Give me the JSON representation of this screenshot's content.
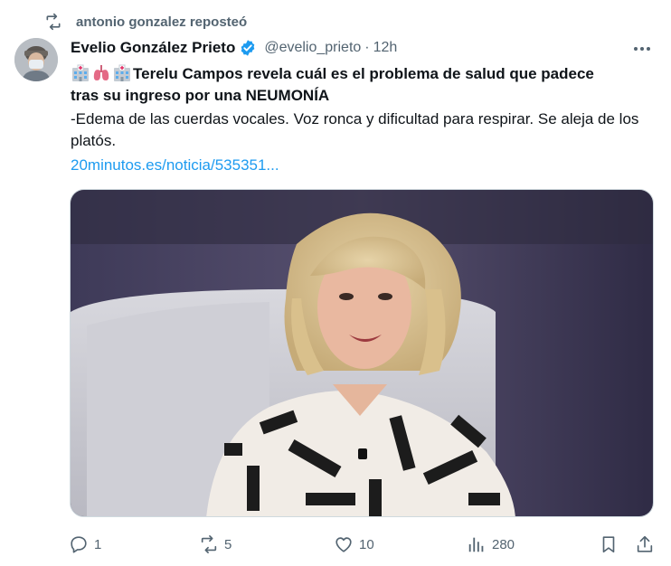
{
  "repost": {
    "text": "antonio gonzalez reposteó",
    "icon": "repost-icon"
  },
  "author": {
    "name": "Evelio González Prieto",
    "handle": "@evelio_prieto",
    "separator": "·",
    "time": "12h",
    "verified": true
  },
  "tweet": {
    "headline_line1": "Terelu Campos revela cuál es el problema de salud que padece",
    "headline_line2": "tras su ingreso por una NEUMONÍA",
    "emojis": [
      "hospital-emoji",
      "lungs-emoji",
      "hospital-emoji"
    ],
    "description": "-Edema de las cuerdas vocales. Voz ronca y dificultad para respirar. Se aleja de los platós.",
    "link": "20minutos.es/noticia/535351..."
  },
  "actions": {
    "replies": "1",
    "reposts": "5",
    "likes": "10",
    "views": "280"
  },
  "colors": {
    "accent": "#1d9bf0",
    "muted": "#536471",
    "text": "#0f1419",
    "border": "#cfd9de"
  }
}
